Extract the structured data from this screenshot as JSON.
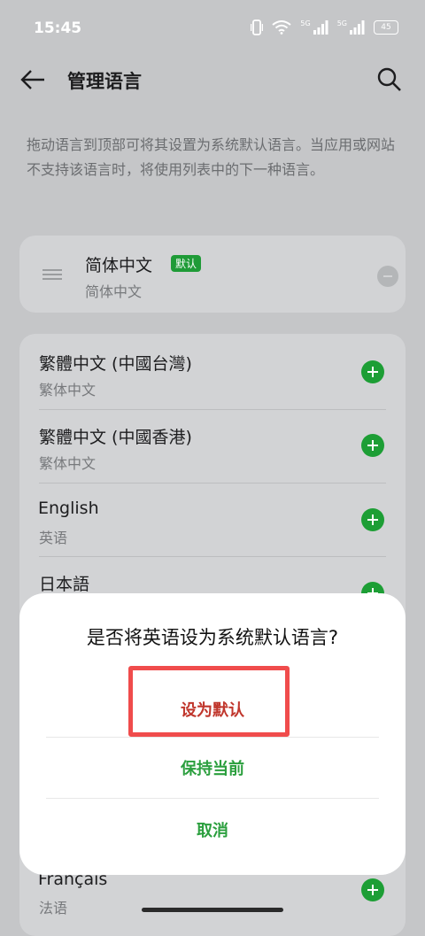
{
  "status_bar": {
    "time": "15:45",
    "signal_label_1": "5G",
    "signal_label_2": "5G",
    "battery": "45"
  },
  "header": {
    "title": "管理语言"
  },
  "description": "拖动语言到顶部可将其设置为系统默认语言。当应用或网站不支持该语言时，将使用列表中的下一种语言。",
  "default_language": {
    "name": "简体中文",
    "badge": "默认",
    "sub": "简体中文"
  },
  "languages": [
    {
      "name": "繁體中文 (中國台灣)",
      "sub": "繁体中文"
    },
    {
      "name": "繁體中文 (中國香港)",
      "sub": "繁体中文"
    },
    {
      "name": "English",
      "sub": "英语"
    },
    {
      "name": "日本語",
      "sub": ""
    },
    {
      "name": "Français",
      "sub": "法语"
    }
  ],
  "dialog": {
    "title": "是否将英语设为系统默认语言?",
    "set_default_label": "设为默认",
    "keep_current_label": "保持当前",
    "cancel_label": "取消"
  },
  "colors": {
    "accent": "#1d9e35",
    "danger": "#c0362c",
    "highlight": "#f04c4c",
    "scrim": "#c5c6c8"
  }
}
